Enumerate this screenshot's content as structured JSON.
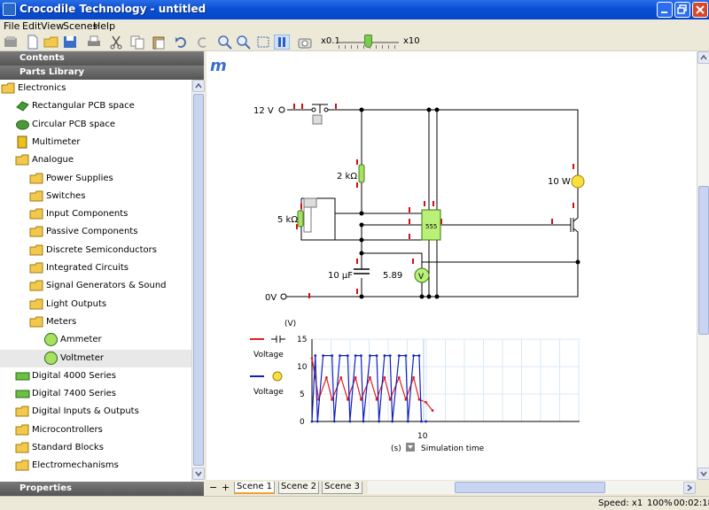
{
  "window": {
    "title": "Crocodile Technology - untitled"
  },
  "menu": [
    "File",
    "Edit",
    "View",
    "Scenes",
    "Help"
  ],
  "toolbar": {
    "zoom_min": "x0.1",
    "zoom_max": "x10",
    "zoom_level": 0.42
  },
  "sidebar": {
    "contents_label": "Contents",
    "library_label": "Parts Library",
    "properties_label": "Properties",
    "items": [
      {
        "label": "Electronics",
        "icon": "folder-icon"
      },
      {
        "label": "Rectangular PCB space",
        "icon": "pcb-rect-icon"
      },
      {
        "label": "Circular PCB space",
        "icon": "pcb-circle-icon"
      },
      {
        "label": "Multimeter",
        "icon": "multimeter-icon"
      },
      {
        "label": "Analogue",
        "icon": "folder-icon"
      },
      {
        "label": "Power Supplies",
        "icon": "folder-icon"
      },
      {
        "label": "Switches",
        "icon": "folder-icon"
      },
      {
        "label": "Input Components",
        "icon": "folder-icon"
      },
      {
        "label": "Passive Components",
        "icon": "folder-icon"
      },
      {
        "label": "Discrete Semiconductors",
        "icon": "folder-icon"
      },
      {
        "label": "Integrated Circuits",
        "icon": "folder-icon"
      },
      {
        "label": "Signal Generators & Sound",
        "icon": "folder-icon"
      },
      {
        "label": "Light Outputs",
        "icon": "folder-icon"
      },
      {
        "label": "Meters",
        "icon": "folder-icon"
      },
      {
        "label": "Ammeter",
        "icon": "ammeter-icon"
      },
      {
        "label": "Voltmeter",
        "icon": "voltmeter-icon"
      },
      {
        "label": "Digital 4000 Series",
        "icon": "chip-icon"
      },
      {
        "label": "Digital 7400 Series",
        "icon": "chip-icon"
      },
      {
        "label": "Digital Inputs & Outputs",
        "icon": "folder-icon"
      },
      {
        "label": "Microcontrollers",
        "icon": "folder-icon"
      },
      {
        "label": "Standard Blocks",
        "icon": "folder-icon"
      },
      {
        "label": "Electromechanisms",
        "icon": "folder-icon"
      }
    ],
    "selected_index": 15
  },
  "circuit": {
    "supply_label": "12 V",
    "ground_label": "0V",
    "r1_label": "2 kΩ",
    "r2_label": "5 kΩ",
    "cap_label": "10 µF",
    "lamp_label": "10 W",
    "voltmeter_reading": "5.89",
    "ic_label": "555",
    "logo": "m"
  },
  "graph": {
    "y_unit_label": "(V)",
    "x_unit_label": "(s)",
    "x_axis_label": "Simulation time",
    "legend": [
      {
        "label": "Voltage",
        "color": "#e02020",
        "icon": "capacitor-icon"
      },
      {
        "label": "Voltage",
        "color": "#1020c0",
        "icon": "lamp-icon"
      }
    ],
    "y_ticks": [
      "15",
      "10",
      "5",
      "0"
    ],
    "x_tick": "10"
  },
  "chart_data": {
    "type": "line",
    "ylim": [
      0,
      15
    ],
    "x_range": [
      0,
      20
    ],
    "series": [
      {
        "name": "Voltage",
        "color": "#e02020",
        "x": [
          0,
          0.3,
          0.6,
          1.3,
          1.8,
          2.6,
          3.2,
          3.9,
          4.4,
          5.2,
          5.8,
          6.5,
          7.0,
          7.8,
          8.4,
          9.1,
          9.6,
          10.2,
          10.8
        ],
        "values": [
          11.5,
          8,
          4,
          8,
          4,
          8,
          4,
          8,
          4,
          8,
          4,
          8,
          4,
          8,
          4,
          8,
          4,
          3.5,
          2
        ]
      },
      {
        "name": "Voltage",
        "color": "#1020c0",
        "x": [
          0,
          0.3,
          0.5,
          1.0,
          1.8,
          2.0,
          2.5,
          3.2,
          3.4,
          3.9,
          4.4,
          4.6,
          5.2,
          5.8,
          6.0,
          6.5,
          7.0,
          7.2,
          7.8,
          8.4,
          8.6,
          9.1,
          9.6,
          9.8,
          10.2
        ],
        "values": [
          0,
          12,
          0,
          12,
          12,
          0,
          12,
          12,
          0,
          12,
          12,
          0,
          12,
          12,
          0,
          12,
          12,
          0,
          12,
          12,
          0,
          12,
          12,
          0,
          0
        ]
      }
    ]
  },
  "scenes": {
    "minus": "−",
    "plus": "+",
    "tabs": [
      "Scene 1",
      "Scene 2",
      "Scene 3"
    ],
    "active": 0
  },
  "status": {
    "speed": "Speed: x1",
    "zoom": "100%",
    "time": "00:02:18"
  }
}
